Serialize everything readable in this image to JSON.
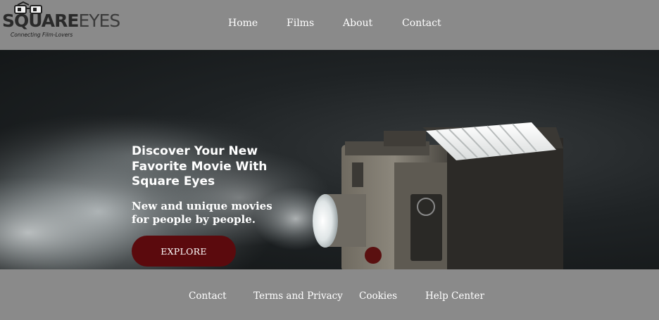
{
  "brand": {
    "name_part1": "SQUARE",
    "name_part2": "EYES",
    "tagline": "Connecting Film-Lovers"
  },
  "nav": {
    "items": [
      {
        "label": "Home"
      },
      {
        "label": "Films"
      },
      {
        "label": "About"
      },
      {
        "label": "Contact"
      }
    ]
  },
  "hero": {
    "title": "Discover Your New Favorite Movie With Square Eyes",
    "subtitle": "New and unique movies for people by people.",
    "cta_label": "EXPLORE",
    "image_icon": "film-projector-icon"
  },
  "footer": {
    "links": [
      {
        "label": "Contact"
      },
      {
        "label": "Terms and Privacy"
      },
      {
        "label": "Cookies"
      },
      {
        "label": "Help Center"
      }
    ]
  },
  "colors": {
    "header_bg": "#8a8a8a",
    "footer_bg": "#8a8a8a",
    "cta_bg": "#5b0a0d",
    "text": "#ffffff"
  }
}
